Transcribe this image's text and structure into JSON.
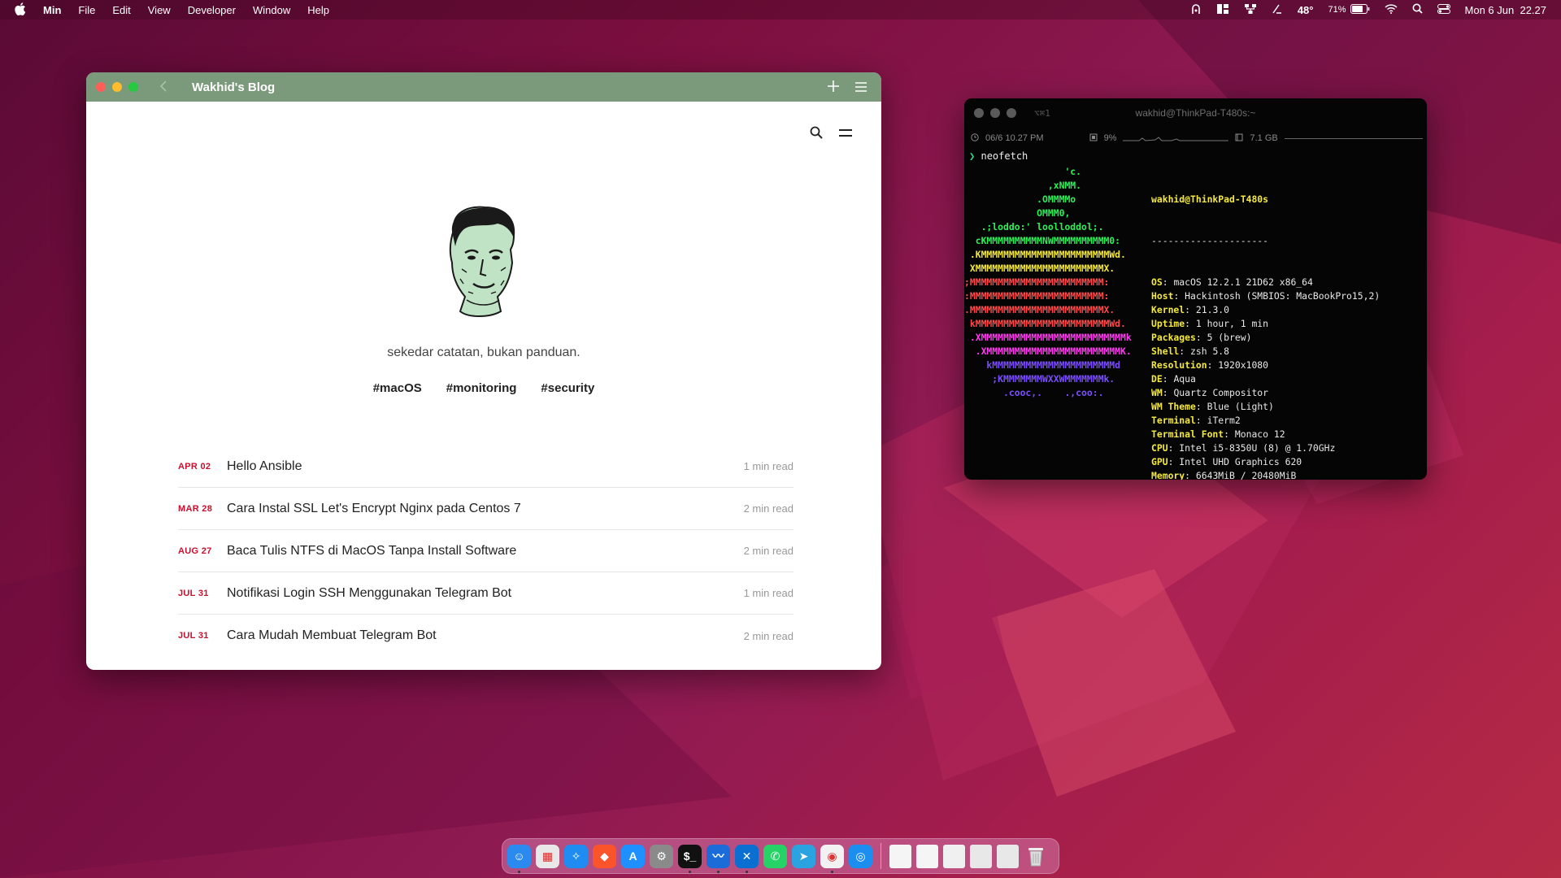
{
  "menubar": {
    "app_name": "Min",
    "menus": [
      "File",
      "Edit",
      "View",
      "Developer",
      "Window",
      "Help"
    ],
    "temperature": "48°",
    "battery_percent": "71%",
    "datetime": "Mon 6 Jun  22.27"
  },
  "browser": {
    "tab_title": "Wakhid's Blog",
    "blog": {
      "tagline": "sekedar catatan, bukan panduan.",
      "tags": [
        "#macOS",
        "#monitoring",
        "#security"
      ],
      "posts": [
        {
          "date": "APR 02",
          "title": "Hello Ansible",
          "read": "1 min read"
        },
        {
          "date": "MAR 28",
          "title": "Cara Instal SSL Let's Encrypt Nginx pada Centos 7",
          "read": "2 min read"
        },
        {
          "date": "AUG 27",
          "title": "Baca Tulis NTFS di MacOS Tanpa Install Software",
          "read": "2 min read"
        },
        {
          "date": "JUL 31",
          "title": "Notifikasi Login SSH Menggunakan Telegram Bot",
          "read": "1 min read"
        },
        {
          "date": "JUL 31",
          "title": "Cara Mudah Membuat Telegram Bot",
          "read": "2 min read"
        }
      ]
    }
  },
  "terminal": {
    "shortcut": "⌥⌘1",
    "host_title": "wakhid@ThinkPad-T480s:~",
    "status": {
      "datetime": "06/6 10.27 PM",
      "cpu": "9%",
      "memory": "7.1 GB"
    },
    "prompt_command": "neofetch",
    "neofetch": {
      "user_host": "wakhid@ThinkPad-T480s",
      "separator": "---------------------",
      "fields": [
        {
          "key": "OS",
          "value": "macOS 12.2.1 21D62 x86_64"
        },
        {
          "key": "Host",
          "value": "Hackintosh (SMBIOS: MacBookPro15,2)"
        },
        {
          "key": "Kernel",
          "value": "21.3.0"
        },
        {
          "key": "Uptime",
          "value": "1 hour, 1 min"
        },
        {
          "key": "Packages",
          "value": "5 (brew)"
        },
        {
          "key": "Shell",
          "value": "zsh 5.8"
        },
        {
          "key": "Resolution",
          "value": "1920x1080"
        },
        {
          "key": "DE",
          "value": "Aqua"
        },
        {
          "key": "WM",
          "value": "Quartz Compositor"
        },
        {
          "key": "WM Theme",
          "value": "Blue (Light)"
        },
        {
          "key": "Terminal",
          "value": "iTerm2"
        },
        {
          "key": "Terminal Font",
          "value": "Monaco 12"
        },
        {
          "key": "CPU",
          "value": "Intel i5-8350U (8) @ 1.70GHz"
        },
        {
          "key": "GPU",
          "value": "Intel UHD Graphics 620"
        },
        {
          "key": "Memory",
          "value": "6643MiB / 20480MiB"
        }
      ],
      "logo_lines": [
        {
          "text": "                  'c.",
          "color": "#2cf05a"
        },
        {
          "text": "               ,xNMM.",
          "color": "#2cf05a"
        },
        {
          "text": "             .OMMMMo",
          "color": "#2cf05a"
        },
        {
          "text": "             OMMM0,",
          "color": "#2cf05a"
        },
        {
          "text": "   .;loddo:' loolloddol;.",
          "color": "#2cf05a"
        },
        {
          "text": "  cKMMMMMMMMMMNWMMMMMMMMMM0:",
          "color": "#2cf05a"
        },
        {
          "text": " .KMMMMMMMMMMMMMMMMMMMMMMMWd.",
          "color": "#f5e93b"
        },
        {
          "text": " XMMMMMMMMMMMMMMMMMMMMMMMX.",
          "color": "#f5e93b"
        },
        {
          "text": ";MMMMMMMMMMMMMMMMMMMMMMMM:",
          "color": "#ff4b4b"
        },
        {
          "text": ":MMMMMMMMMMMMMMMMMMMMMMMM:",
          "color": "#ff4b4b"
        },
        {
          "text": ".MMMMMMMMMMMMMMMMMMMMMMMMX.",
          "color": "#ff4b4b"
        },
        {
          "text": " kMMMMMMMMMMMMMMMMMMMMMMMMWd.",
          "color": "#ff4b4b"
        },
        {
          "text": " .XMMMMMMMMMMMMMMMMMMMMMMMMMMk",
          "color": "#ff3bf0"
        },
        {
          "text": "  .XMMMMMMMMMMMMMMMMMMMMMMMMK.",
          "color": "#ff3bf0"
        },
        {
          "text": "    kMMMMMMMMMMMMMMMMMMMMMMd",
          "color": "#7b4dff"
        },
        {
          "text": "     ;KMMMMMMMWXXWMMMMMMMk.",
          "color": "#7b4dff"
        },
        {
          "text": "       .cooc,.    .,coo:.",
          "color": "#7b4dff"
        }
      ],
      "palette_top": [
        "#000000",
        "#d70000",
        "#00e65a",
        "#e6e600",
        "#4a3aff",
        "#ff2bd6",
        "#00e0e0",
        "#c8c8c8"
      ],
      "palette_bottom": [
        "#666666",
        "#ff3b3b",
        "#3bff7b",
        "#ffff3b",
        "#7b6bff",
        "#ff5bf0",
        "#3bffff",
        "#ffffff"
      ]
    }
  },
  "dock": {
    "apps": [
      {
        "name": "finder-icon",
        "bg": "#2a8af0",
        "glyph": "☺"
      },
      {
        "name": "launchpad-icon",
        "bg": "#e8e8e8",
        "glyph": "▦"
      },
      {
        "name": "safari-icon",
        "bg": "#1e8cf0",
        "glyph": "✧"
      },
      {
        "name": "brave-icon",
        "bg": "#fb542b",
        "glyph": "◆"
      },
      {
        "name": "app-store-icon",
        "bg": "#1e90ff",
        "glyph": "A"
      },
      {
        "name": "system-preferences-icon",
        "bg": "#8a8a8a",
        "glyph": "⚙"
      },
      {
        "name": "iterm-icon",
        "bg": "#111111",
        "glyph": "$_"
      },
      {
        "name": "activity-monitor-icon",
        "bg": "#1b6bd8",
        "glyph": "〰"
      },
      {
        "name": "vscode-icon",
        "bg": "#0a6fd1",
        "glyph": "✕"
      },
      {
        "name": "whatsapp-icon",
        "bg": "#25d366",
        "glyph": "✆"
      },
      {
        "name": "telegram-icon",
        "bg": "#2aa3e0",
        "glyph": "➤"
      },
      {
        "name": "chrome-icon",
        "bg": "#f2f2f2",
        "glyph": "◉"
      },
      {
        "name": "min-browser-icon",
        "bg": "#1c8ef0",
        "glyph": "◎"
      }
    ],
    "docs": [
      {
        "name": "document-thumbnail-icon",
        "bg": "#f5f5f5"
      },
      {
        "name": "document-thumbnail-icon",
        "bg": "#f5f5f5"
      },
      {
        "name": "document-thumbnail-icon",
        "bg": "#f0f0f0"
      },
      {
        "name": "screenshot-thumbnail-icon",
        "bg": "#e8e8e8"
      },
      {
        "name": "screenshot-thumbnail-icon",
        "bg": "#e8e8e8"
      }
    ]
  }
}
